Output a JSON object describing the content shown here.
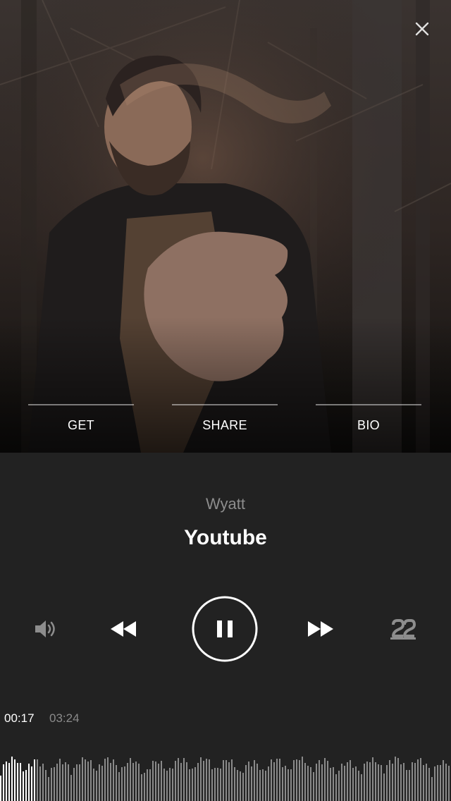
{
  "hero": {
    "close_icon": "close-icon",
    "actions": [
      {
        "label": "GET"
      },
      {
        "label": "SHARE"
      },
      {
        "label": "BIO"
      }
    ]
  },
  "track": {
    "artist": "Wyatt",
    "title": "Youtube"
  },
  "controls": {
    "volume_icon": "volume-icon",
    "rewind_icon": "rewind-icon",
    "pause_icon": "pause-icon",
    "forward_icon": "fast-forward-icon",
    "repeat_icon": "repeat-icon"
  },
  "progress": {
    "current_time": "00:17",
    "total_time": "03:24",
    "fraction": 0.083
  },
  "colors": {
    "panel_bg": "#222222",
    "played": "#ffffff",
    "unplayed": "#8a8a8a",
    "muted_text": "#8d8d8d"
  }
}
